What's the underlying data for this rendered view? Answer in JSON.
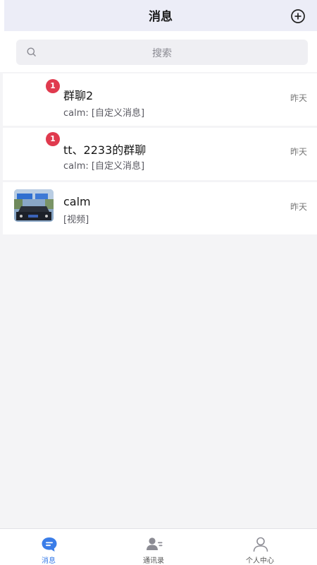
{
  "header": {
    "title": "消息"
  },
  "search": {
    "placeholder": "搜索"
  },
  "conversations": [
    {
      "name": "群聊2",
      "preview": "calm: [自定义消息]",
      "time": "昨天",
      "unread": "1"
    },
    {
      "name": "tt、2233的群聊",
      "preview": "calm: [自定义消息]",
      "time": "昨天",
      "unread": "1"
    },
    {
      "name": "calm",
      "preview": "[视频]",
      "time": "昨天"
    }
  ],
  "tabbar": {
    "items": [
      {
        "label": "消息",
        "icon": "chat-bubble-icon",
        "active": true
      },
      {
        "label": "通讯录",
        "icon": "contacts-icon"
      },
      {
        "label": "个人中心",
        "icon": "person-icon"
      }
    ]
  },
  "colors": {
    "accent": "#3a7de8",
    "badge": "#e03a4e",
    "header_bg": "#ecedf7"
  }
}
